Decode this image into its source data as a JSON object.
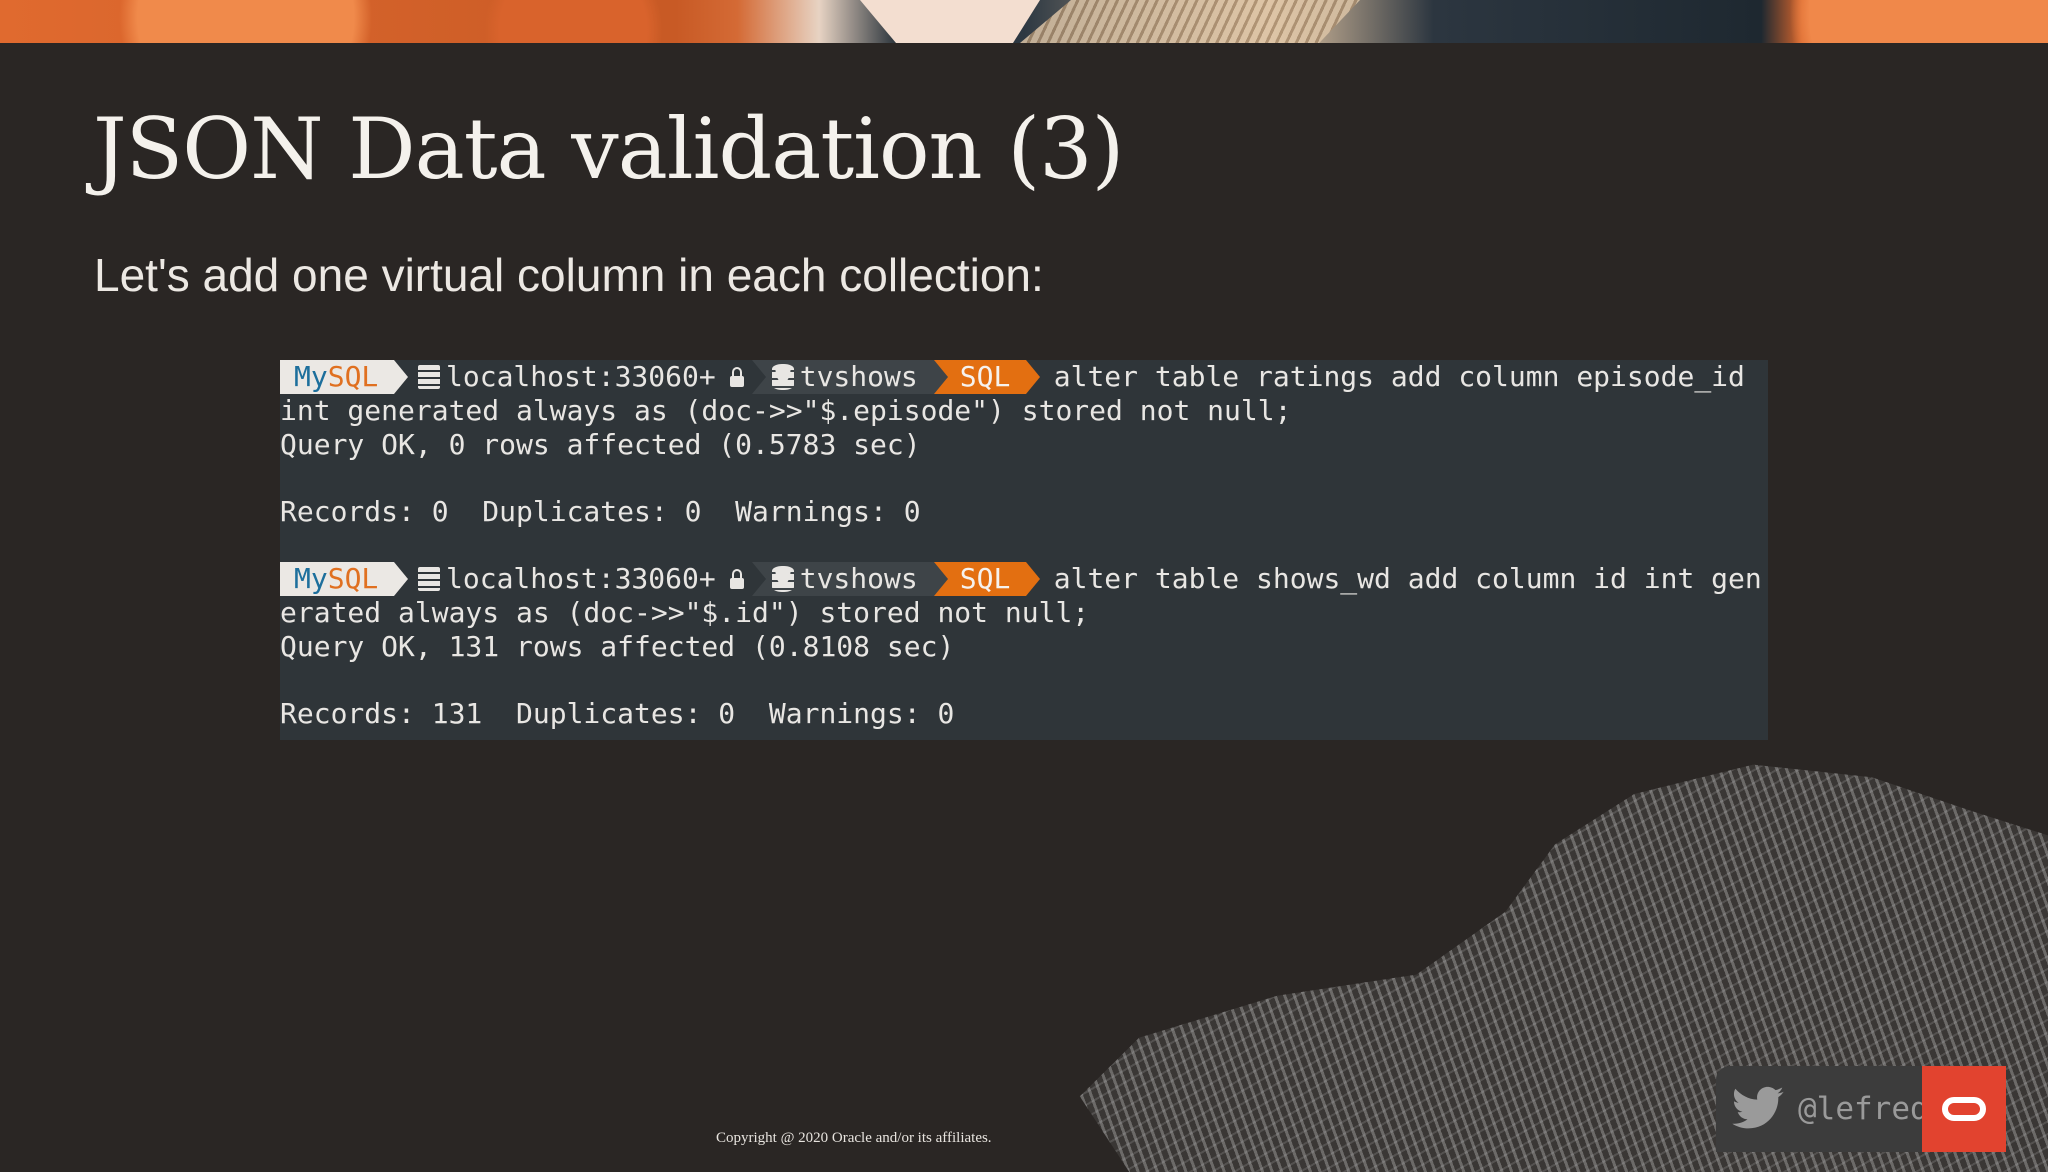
{
  "slide": {
    "title": "JSON Data validation (3)",
    "subtitle": "Let's add one virtual column in each collection:"
  },
  "prompt": {
    "mysql_my": "My",
    "mysql_sql": "SQL",
    "host": "localhost:33060+",
    "schema": "tvshows",
    "mode": "SQL"
  },
  "terminal": {
    "block1": {
      "command_part1": "alter table ratings add column episode_id",
      "command_part2": "int generated always as (doc->>\"$.episode\") stored not null;",
      "result": "Query OK, 0 rows affected (0.5783 sec)",
      "records": "Records: 0  Duplicates: 0  Warnings: 0"
    },
    "block2": {
      "command_part1": "alter table shows_wd add column id int gen",
      "command_part2": "erated always as (doc->>\"$.id\") stored not null;",
      "result": "Query OK, 131 rows affected (0.8108 sec)",
      "records": "Records: 131  Duplicates: 0  Warnings: 0"
    }
  },
  "footer": {
    "copyright": "Copyright @ 2020 Oracle and/or its affiliates.",
    "twitter_handle": "@lefred"
  },
  "colors": {
    "background": "#2a2624",
    "terminal_bg": "#2f3539",
    "mode_segment": "#e36f11",
    "oracle_red": "#e2432f"
  }
}
